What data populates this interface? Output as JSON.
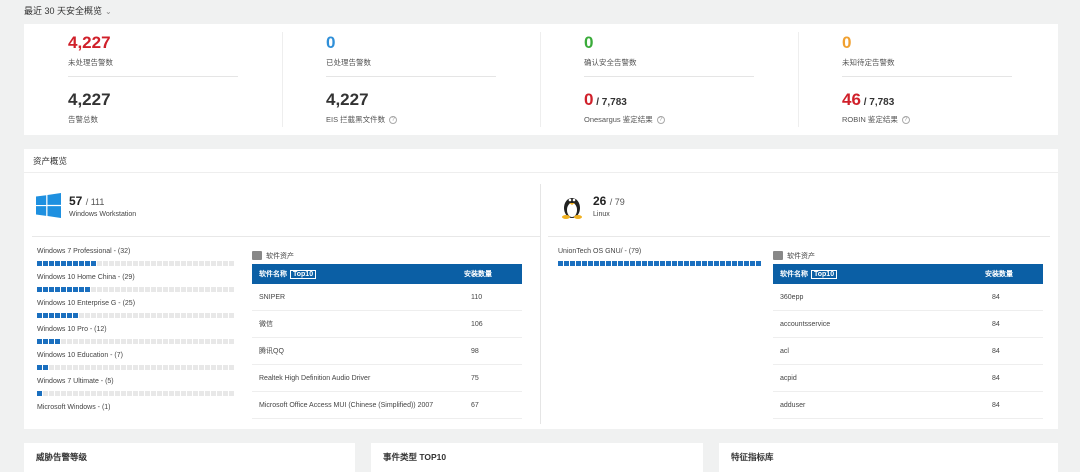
{
  "header": {
    "title": "最近 30 天安全概览",
    "chevron": "⌄"
  },
  "colors": {
    "red": "#d0202a",
    "blue": "#2f8fd8",
    "green": "#3aab3a",
    "orange": "#f0a030",
    "table_header": "#0b5fa5",
    "bar": "#1a6fbf"
  },
  "stats": [
    {
      "top_value": "4,227",
      "top_label": "未处理告警数",
      "top_color": "#d0202a",
      "bottom_value": "4,227",
      "bottom_total": "",
      "bottom_label": "告警总数",
      "bottom_color": "#333",
      "help": false
    },
    {
      "top_value": "0",
      "top_label": "已处理告警数",
      "top_color": "#2f8fd8",
      "bottom_value": "4,227",
      "bottom_total": "",
      "bottom_label": "EIS 拦截黑文件数",
      "bottom_color": "#333",
      "help": true
    },
    {
      "top_value": "0",
      "top_label": "确认安全告警数",
      "top_color": "#3aab3a",
      "bottom_value": "0",
      "bottom_total": " / 7,783",
      "bottom_label": "Onesargus 鉴定结果",
      "bottom_color": "#d0202a",
      "help": true
    },
    {
      "top_value": "0",
      "top_label": "未知待定告警数",
      "top_color": "#f0a030",
      "bottom_value": "46",
      "bottom_total": " / 7,783",
      "bottom_label": "ROBIN 鉴定结果",
      "bottom_color": "#d0202a",
      "help": true
    }
  ],
  "assets": {
    "title": "资产概览",
    "windows": {
      "count": "57",
      "total": "/ 111",
      "name": "Windows Workstation",
      "os_list": [
        {
          "label": "Windows 7 Professional - (32)",
          "value": 32
        },
        {
          "label": "Windows 10 Home China - (29)",
          "value": 29
        },
        {
          "label": "Windows 10 Enterprise G - (25)",
          "value": 25
        },
        {
          "label": "Windows 10 Pro - (12)",
          "value": 12
        },
        {
          "label": "Windows 10 Education - (7)",
          "value": 7
        },
        {
          "label": "Windows 7 Ultimate - (5)",
          "value": 5
        },
        {
          "label": "Microsoft Windows - (1)",
          "value": 1
        }
      ],
      "max": 111,
      "software": {
        "title": "软件资产",
        "col1": "软件名称",
        "tag": "Top10",
        "col2": "安装数量",
        "rows": [
          [
            "SNIPER",
            "110"
          ],
          [
            "微信",
            "106"
          ],
          [
            "腾讯QQ",
            "98"
          ],
          [
            "Realtek High Definition Audio Driver",
            "75"
          ],
          [
            "Microsoft Office Access MUI (Chinese (Simplified)) 2007",
            "67"
          ]
        ]
      }
    },
    "linux": {
      "count": "26",
      "total": "/ 79",
      "name": "Linux",
      "os_list": [
        {
          "label": "UnionTech OS GNU/ - (79)",
          "value": 79
        }
      ],
      "max": 79,
      "software": {
        "title": "软件资产",
        "col1": "软件名称",
        "tag": "Top10",
        "col2": "安装数量",
        "rows": [
          [
            "360epp",
            "84"
          ],
          [
            "accountsservice",
            "84"
          ],
          [
            "acl",
            "84"
          ],
          [
            "acpid",
            "84"
          ],
          [
            "adduser",
            "84"
          ]
        ]
      }
    }
  },
  "bottom": {
    "cards": [
      "威胁告警等级",
      "事件类型 TOP10",
      "特征指标库"
    ]
  }
}
